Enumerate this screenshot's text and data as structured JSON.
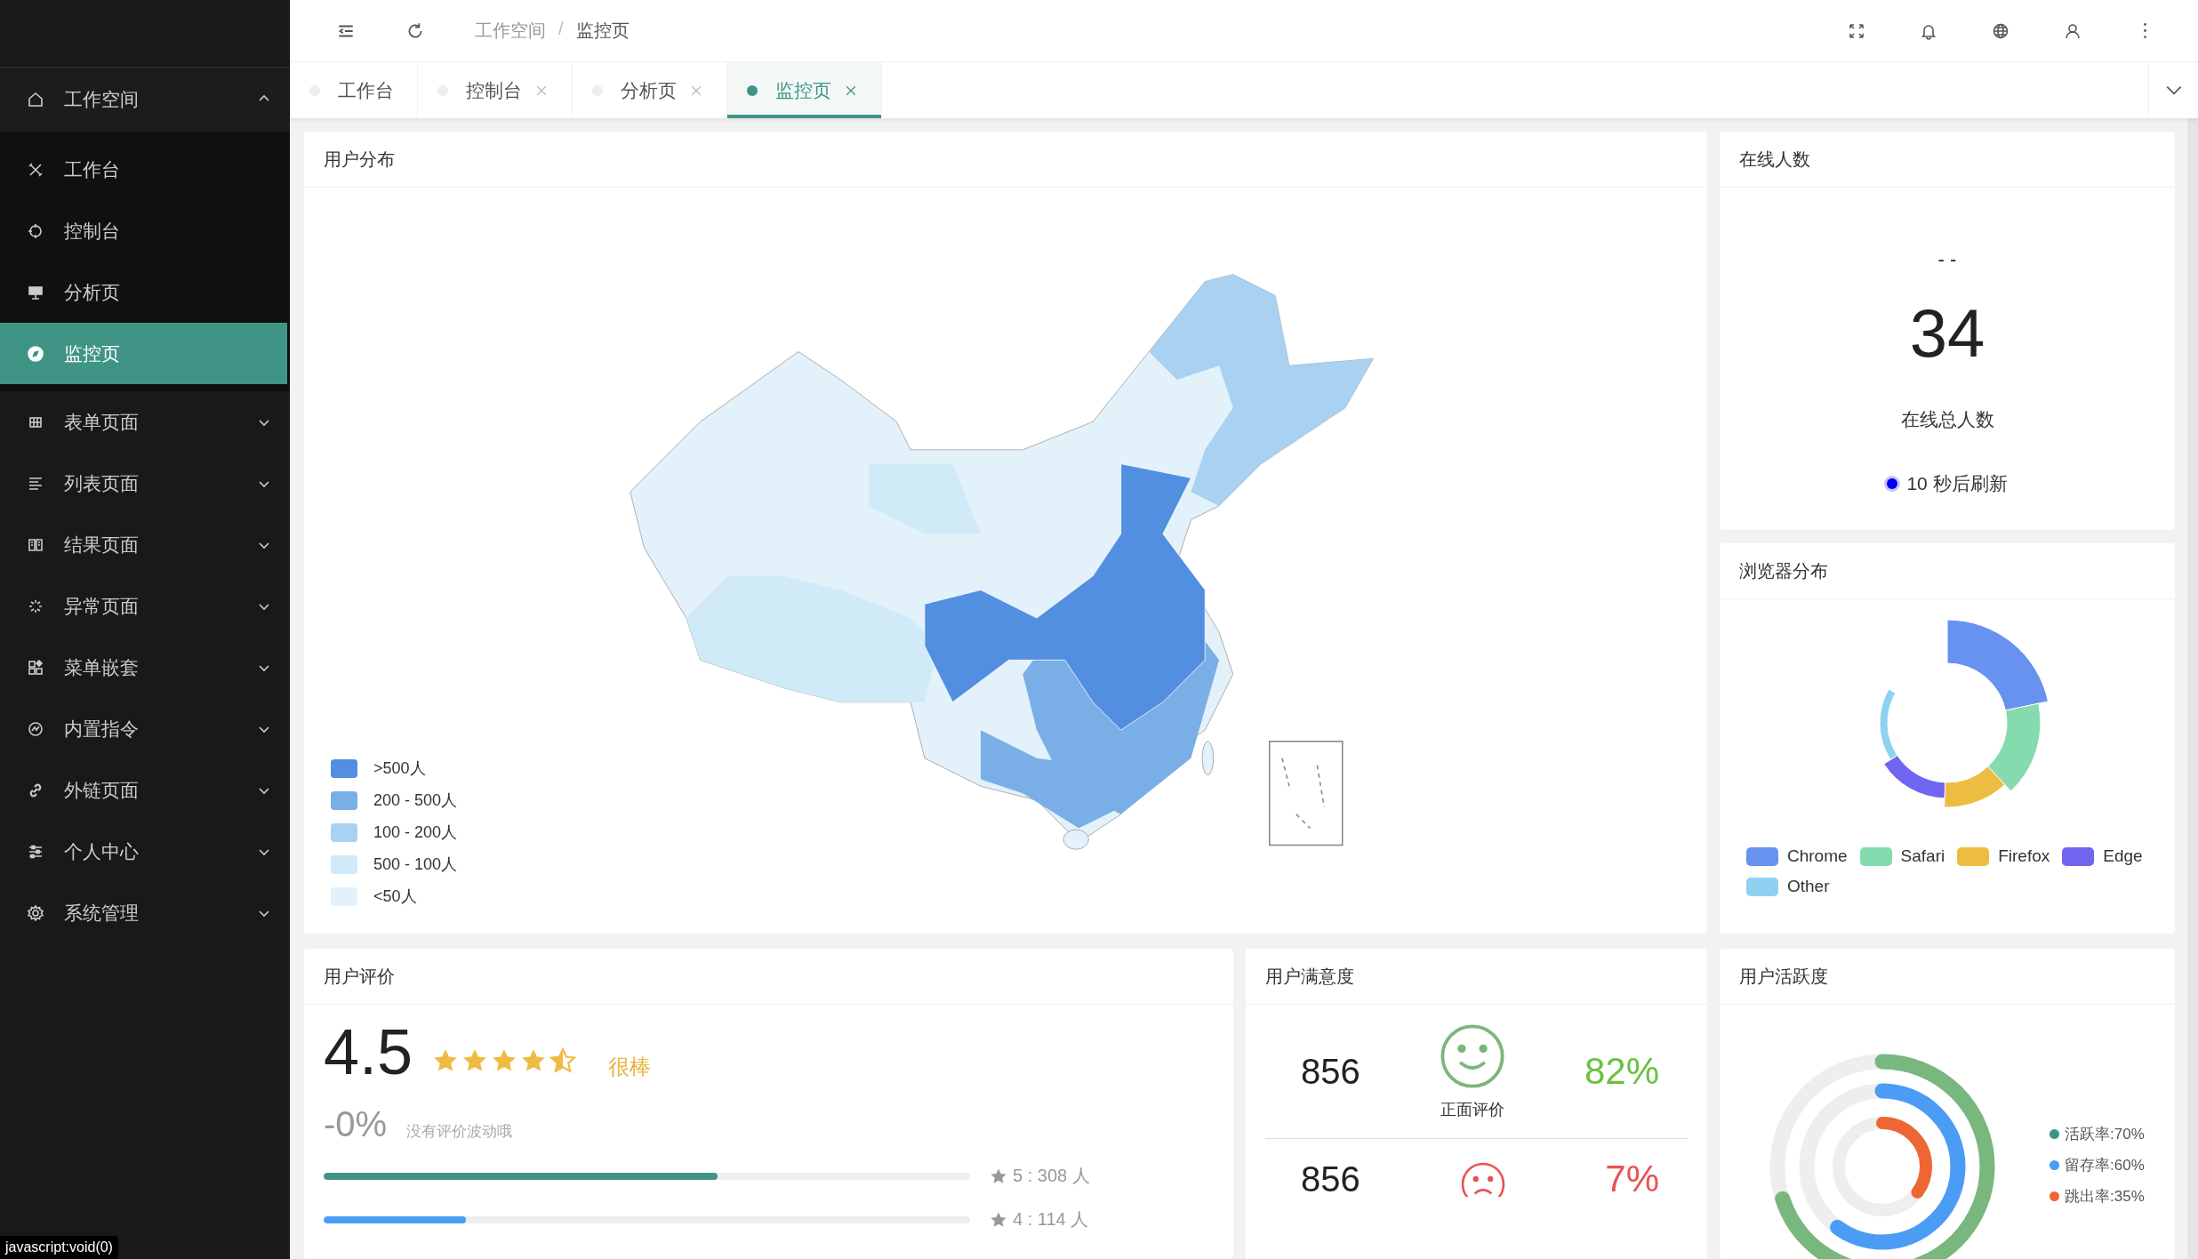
{
  "sidebar": {
    "items": [
      {
        "label": "工作空间",
        "expanded": true,
        "children": [
          {
            "label": "工作台",
            "selected": false
          },
          {
            "label": "控制台",
            "selected": false
          },
          {
            "label": "分析页",
            "selected": false
          },
          {
            "label": "监控页",
            "selected": true
          }
        ]
      },
      {
        "label": "表单页面",
        "expanded": false
      },
      {
        "label": "列表页面",
        "expanded": false
      },
      {
        "label": "结果页面",
        "expanded": false
      },
      {
        "label": "异常页面",
        "expanded": false
      },
      {
        "label": "菜单嵌套",
        "expanded": false
      },
      {
        "label": "内置指令",
        "expanded": false
      },
      {
        "label": "外链页面",
        "expanded": false
      },
      {
        "label": "个人中心",
        "expanded": false
      },
      {
        "label": "系统管理",
        "expanded": false
      }
    ]
  },
  "header": {
    "breadcrumb": [
      "工作空间",
      "监控页"
    ],
    "separator": "/"
  },
  "tabs": [
    {
      "label": "工作台",
      "selected": false,
      "closable": false
    },
    {
      "label": "控制台",
      "selected": false,
      "closable": true
    },
    {
      "label": "分析页",
      "selected": false,
      "closable": true
    },
    {
      "label": "监控页",
      "selected": true,
      "closable": true
    }
  ],
  "user_distribution": {
    "title": "用户分布",
    "legend": [
      {
        "label": ">500人",
        "color": "#528fe0"
      },
      {
        "label": "200 - 500人",
        "color": "#7aaee6"
      },
      {
        "label": "100 - 200人",
        "color": "#a8d1f2"
      },
      {
        "label": "500 - 100人",
        "color": "#d0ebf7"
      },
      {
        "label": "<50人",
        "color": "#e3f1fa"
      }
    ]
  },
  "online": {
    "title": "在线人数",
    "previous": "- -",
    "count": "34",
    "caption": "在线总人数",
    "refresh": "10 秒后刷新"
  },
  "browsers": {
    "title": "浏览器分布",
    "legend": [
      {
        "label": "Chrome",
        "color": "#6792f0"
      },
      {
        "label": "Safari",
        "color": "#85dbae"
      },
      {
        "label": "Firefox",
        "color": "#edbd42"
      },
      {
        "label": "Edge",
        "color": "#7065f0"
      },
      {
        "label": "Other",
        "color": "#8fd1f3"
      }
    ]
  },
  "rating": {
    "title": "用户评价",
    "score": "4.5",
    "stars": 4.5,
    "verdict": "很棒",
    "change": "-0%",
    "note": "没有评价波动哦",
    "bars": [
      {
        "label": "5 : 308 人",
        "level": 0.61,
        "color": "#3f9485"
      },
      {
        "label": "4 : 114 人",
        "level": 0.22,
        "color": "#4b9cf5"
      }
    ]
  },
  "satisfaction": {
    "title": "用户满意度",
    "rows": [
      {
        "kind": "positive",
        "count": "856",
        "label": "正面评价",
        "percent": "82%"
      },
      {
        "kind": "negative",
        "count": "856",
        "percent": "7%"
      }
    ]
  },
  "activity": {
    "title": "用户活跃度",
    "rings": [
      {
        "label": "活跃率:70%",
        "color": "#3f9485"
      },
      {
        "label": "留存率:60%",
        "color": "#4b9cf5"
      },
      {
        "label": "跳出率:35%",
        "color": "#ee6633"
      }
    ]
  },
  "status_tooltip": "javascript:void(0)"
}
